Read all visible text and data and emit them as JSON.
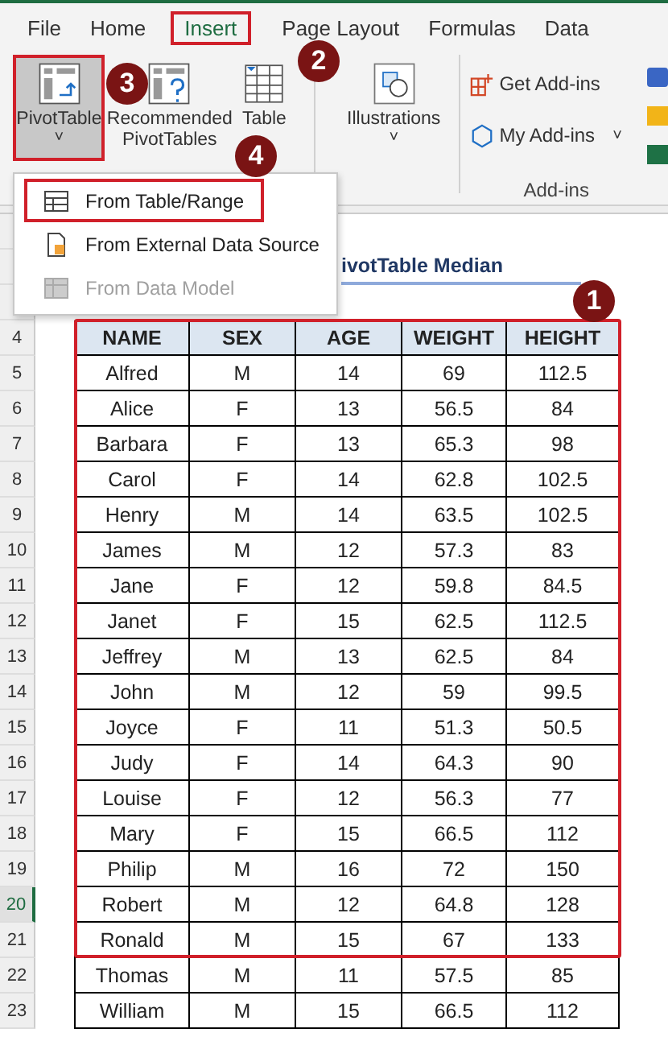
{
  "ribbon_tabs": [
    {
      "label": "File",
      "selected": false,
      "annotated": false
    },
    {
      "label": "Home",
      "selected": false,
      "annotated": false
    },
    {
      "label": "Insert",
      "selected": true,
      "annotated": true
    },
    {
      "label": "Page Layout",
      "selected": false,
      "annotated": false
    },
    {
      "label": "Formulas",
      "selected": false,
      "annotated": false
    },
    {
      "label": "Data",
      "selected": false,
      "annotated": false
    }
  ],
  "ribbon": {
    "pivot_table": {
      "label": "PivotTable",
      "caret": "˅",
      "pressed": true,
      "annotated": true
    },
    "recommended": {
      "line_1": "Recommended",
      "line_2": "PivotTables"
    },
    "table": {
      "label": "Table"
    },
    "illustrations": {
      "label": "Illustrations",
      "caret": "˅"
    },
    "get_add_ins": "Get Add-ins",
    "my_add_ins": {
      "label": "My Add-ins",
      "caret": "˅"
    },
    "add_ins_group": "Add-ins"
  },
  "pivot_menu": [
    {
      "label": "From Table/Range",
      "disabled": false,
      "annotated": true
    },
    {
      "label": "From External Data Source",
      "disabled": false,
      "annotated": false
    },
    {
      "label": "From Data Model",
      "disabled": true,
      "annotated": false
    }
  ],
  "sheet": {
    "title": "ivotTable Median",
    "header_row": "4",
    "columns": [
      "NAME",
      "SEX",
      "AGE",
      "WEIGHT",
      "HEIGHT"
    ],
    "rows": [
      {
        "row_number": "5",
        "selected": false,
        "cells": [
          "Alfred",
          "M",
          "14",
          "69",
          "112.5"
        ]
      },
      {
        "row_number": "6",
        "selected": false,
        "cells": [
          "Alice",
          "F",
          "13",
          "56.5",
          "84"
        ]
      },
      {
        "row_number": "7",
        "selected": false,
        "cells": [
          "Barbara",
          "F",
          "13",
          "65.3",
          "98"
        ]
      },
      {
        "row_number": "8",
        "selected": false,
        "cells": [
          "Carol",
          "F",
          "14",
          "62.8",
          "102.5"
        ]
      },
      {
        "row_number": "9",
        "selected": false,
        "cells": [
          "Henry",
          "M",
          "14",
          "63.5",
          "102.5"
        ]
      },
      {
        "row_number": "10",
        "selected": false,
        "cells": [
          "James",
          "M",
          "12",
          "57.3",
          "83"
        ]
      },
      {
        "row_number": "11",
        "selected": false,
        "cells": [
          "Jane",
          "F",
          "12",
          "59.8",
          "84.5"
        ]
      },
      {
        "row_number": "12",
        "selected": false,
        "cells": [
          "Janet",
          "F",
          "15",
          "62.5",
          "112.5"
        ]
      },
      {
        "row_number": "13",
        "selected": false,
        "cells": [
          "Jeffrey",
          "M",
          "13",
          "62.5",
          "84"
        ]
      },
      {
        "row_number": "14",
        "selected": false,
        "cells": [
          "John",
          "M",
          "12",
          "59",
          "99.5"
        ]
      },
      {
        "row_number": "15",
        "selected": false,
        "cells": [
          "Joyce",
          "F",
          "11",
          "51.3",
          "50.5"
        ]
      },
      {
        "row_number": "16",
        "selected": false,
        "cells": [
          "Judy",
          "F",
          "14",
          "64.3",
          "90"
        ]
      },
      {
        "row_number": "17",
        "selected": false,
        "cells": [
          "Louise",
          "F",
          "12",
          "56.3",
          "77"
        ]
      },
      {
        "row_number": "18",
        "selected": false,
        "cells": [
          "Mary",
          "F",
          "15",
          "66.5",
          "112"
        ]
      },
      {
        "row_number": "19",
        "selected": false,
        "cells": [
          "Philip",
          "M",
          "16",
          "72",
          "150"
        ]
      },
      {
        "row_number": "20",
        "selected": true,
        "cells": [
          "Robert",
          "M",
          "12",
          "64.8",
          "128"
        ]
      },
      {
        "row_number": "21",
        "selected": false,
        "cells": [
          "Ronald",
          "M",
          "15",
          "67",
          "133"
        ]
      },
      {
        "row_number": "22",
        "selected": false,
        "cells": [
          "Thomas",
          "M",
          "11",
          "57.5",
          "85"
        ]
      },
      {
        "row_number": "23",
        "selected": false,
        "cells": [
          "William",
          "M",
          "15",
          "66.5",
          "112"
        ]
      }
    ]
  },
  "annotations": [
    "1",
    "2",
    "3",
    "4"
  ]
}
